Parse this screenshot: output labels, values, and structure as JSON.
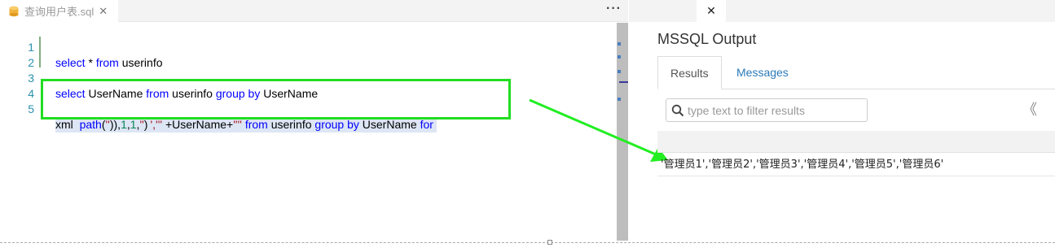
{
  "editor": {
    "tab_label": "查询用户表.sql",
    "tab_close": "✕",
    "more_menu": "···",
    "lines": [
      {
        "num": "1"
      },
      {
        "num": "2"
      },
      {
        "num": "3"
      },
      {
        "num": "4"
      },
      {
        "num": "5"
      }
    ]
  },
  "output": {
    "tab_close": "✕",
    "title": "MSSQL Output",
    "tabs": {
      "results": "Results",
      "messages": "Messages"
    },
    "filter_placeholder": "type text to filter results",
    "pager_prev": "《",
    "pager_next": "〈",
    "result_value": "'管理员1','管理员2','管理员3','管理员4','管理员5','管理员6'"
  },
  "colors": {
    "annotation": "#22dd22",
    "keyword": "#0000ff",
    "link": "#2a7ab8"
  }
}
